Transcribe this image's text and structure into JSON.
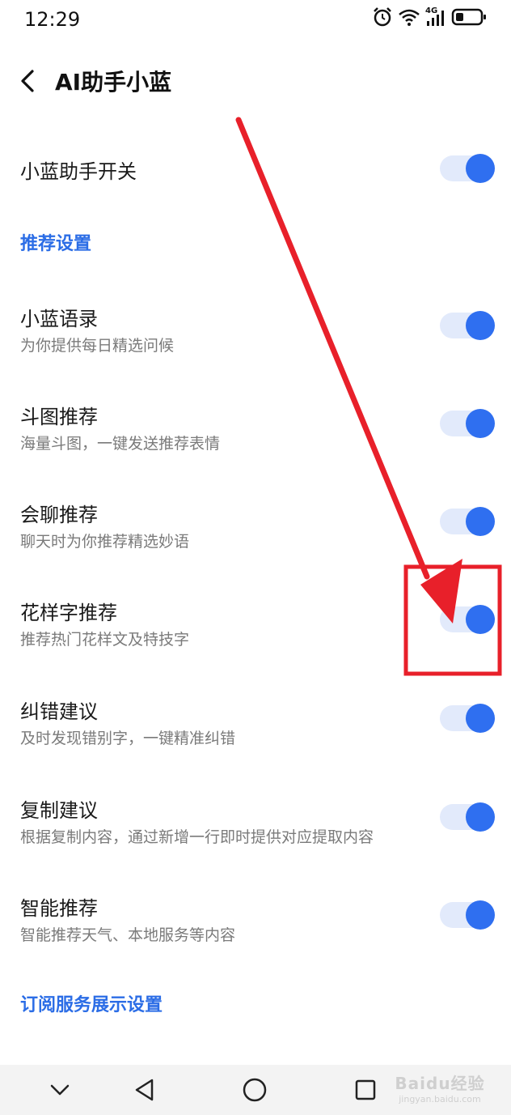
{
  "status_bar": {
    "time": "12:29",
    "network": "4G"
  },
  "header": {
    "title": "AI助手小蓝"
  },
  "main_toggle": {
    "label": "小蓝助手开关",
    "on": true
  },
  "sections": {
    "recommend": "推荐设置",
    "subscribe": "订阅服务展示设置"
  },
  "settings": [
    {
      "title": "小蓝语录",
      "subtitle": "为你提供每日精选问候",
      "on": true
    },
    {
      "title": "斗图推荐",
      "subtitle": "海量斗图，一键发送推荐表情",
      "on": true
    },
    {
      "title": "会聊推荐",
      "subtitle": "聊天时为你推荐精选妙语",
      "on": true
    },
    {
      "title": "花样字推荐",
      "subtitle": "推荐热门花样文及特技字",
      "on": true
    },
    {
      "title": "纠错建议",
      "subtitle": "及时发现错别字，一键精准纠错",
      "on": true
    },
    {
      "title": "复制建议",
      "subtitle": "根据复制内容，通过新增一行即时提供对应提取内容",
      "on": true
    },
    {
      "title": "智能推荐",
      "subtitle": "智能推荐天气、本地服务等内容",
      "on": true
    }
  ],
  "watermark": {
    "brand": "Baidu经验",
    "url": "jingyan.baidu.com"
  },
  "colors": {
    "accent": "#2f6ff0",
    "section_text": "#2b6de6",
    "annotation_red": "#e8202a"
  },
  "icons": [
    "alarm-icon",
    "wifi-icon",
    "signal-icon",
    "battery-icon",
    "back-icon",
    "nav-down-icon",
    "nav-back-icon",
    "nav-home-icon",
    "nav-recents-icon"
  ]
}
